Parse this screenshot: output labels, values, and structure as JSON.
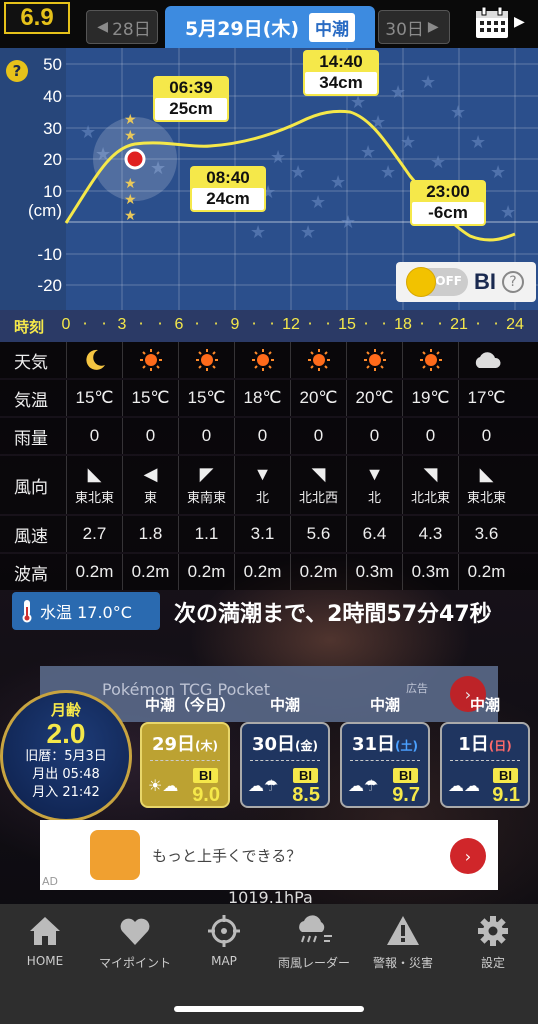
{
  "header": {
    "tide_index": "6.9",
    "prev_day": "28日",
    "date": "5月29日(木)",
    "tide_type": "中潮",
    "next_day": "30日"
  },
  "chart": {
    "help_label": "?",
    "y_ticks": [
      "50",
      "40",
      "30",
      "20",
      "10",
      "(cm)",
      "-10",
      "-20"
    ],
    "callouts": [
      {
        "time": "06:39",
        "value": "25cm"
      },
      {
        "time": "14:40",
        "value": "34cm"
      },
      {
        "time": "08:40",
        "value": "24cm"
      },
      {
        "time": "23:00",
        "value": "-6cm"
      }
    ],
    "bi_toggle": {
      "state": "OFF",
      "label": "BI",
      "help": "?"
    }
  },
  "time_row": {
    "label": "時刻",
    "ticks": [
      "0",
      "3",
      "6",
      "9",
      "12",
      "15",
      "18",
      "21",
      "24"
    ]
  },
  "weather": {
    "rows": [
      {
        "head": "天気",
        "cells": [
          "moon",
          "sun",
          "sun",
          "sun",
          "sun",
          "sun",
          "sun",
          "cloud"
        ]
      },
      {
        "head": "気温",
        "cells": [
          "15℃",
          "15℃",
          "15℃",
          "18℃",
          "20℃",
          "20℃",
          "19℃",
          "17℃"
        ]
      },
      {
        "head": "雨量",
        "cells": [
          "0",
          "0",
          "0",
          "0",
          "0",
          "0",
          "0",
          "0"
        ]
      },
      {
        "head": "風向",
        "cells": [
          "東北東",
          "東",
          "東南東",
          "北",
          "北北西",
          "北",
          "北北東",
          "東北東"
        ]
      },
      {
        "head": "風速",
        "cells": [
          "2.7",
          "1.8",
          "1.1",
          "3.1",
          "5.6",
          "6.4",
          "4.3",
          "3.6"
        ]
      },
      {
        "head": "波高",
        "cells": [
          "0.2m",
          "0.2m",
          "0.2m",
          "0.2m",
          "0.2m",
          "0.3m",
          "0.3m",
          "0.2m"
        ]
      }
    ],
    "wind_arrows": [
      "◣",
      "◀",
      "◤",
      "▼",
      "◥",
      "▼",
      "◥",
      "◣"
    ]
  },
  "water_temp": "水温 17.0°C",
  "countdown": "次の満潮まで、2時間57分47秒",
  "ad_banner": {
    "title": "Pokémon TCG Pocket",
    "tag": "広告"
  },
  "moon": {
    "label": "月齢",
    "age": "2.0",
    "lunar": "旧暦：5月3日",
    "rise": "月出 05:48",
    "set": "月入 21:42"
  },
  "tide_labels": [
    "中潮（今日）",
    "中潮",
    "中潮",
    "中潮"
  ],
  "day_cards": [
    {
      "date": "29日",
      "dow": "(木)",
      "bi_label": "BI",
      "bi": "9.0"
    },
    {
      "date": "30日",
      "dow": "(金)",
      "bi_label": "BI",
      "bi": "8.5"
    },
    {
      "date": "31日",
      "dow": "(土)",
      "bi_label": "BI",
      "bi": "9.7"
    },
    {
      "date": "1日",
      "dow": "(日)",
      "bi_label": "BI",
      "bi": "9.1"
    }
  ],
  "ad2": {
    "text": "もっと上手くできる？",
    "mark": "AD"
  },
  "pressure": "1019.1hPa",
  "nav": [
    {
      "label": "HOME",
      "icon": "home-icon"
    },
    {
      "label": "マイポイント",
      "icon": "heart-icon"
    },
    {
      "label": "MAP",
      "icon": "crosshair-icon"
    },
    {
      "label": "雨風レーダー",
      "icon": "rain-cloud-icon"
    },
    {
      "label": "警報・災害",
      "icon": "warning-icon"
    },
    {
      "label": "設定",
      "icon": "gear-icon"
    }
  ]
}
